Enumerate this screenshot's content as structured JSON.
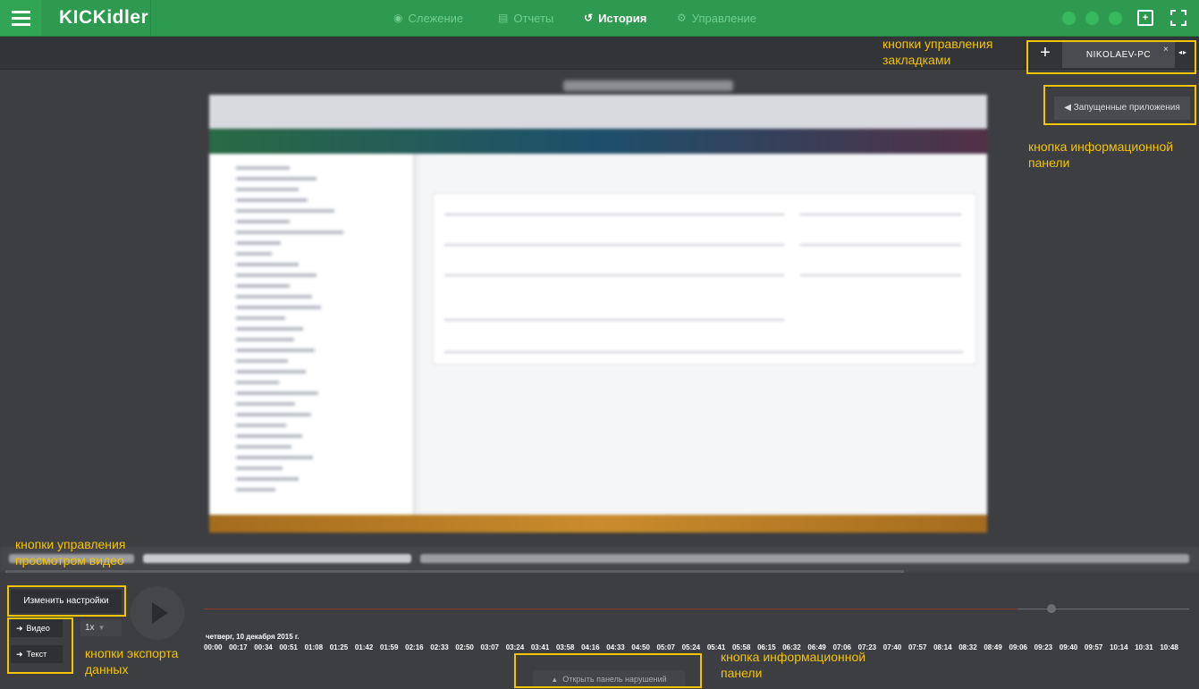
{
  "app": {
    "logo": "KICKidler"
  },
  "nav": [
    {
      "label": "Слежение",
      "icon": "eye-icon",
      "active": false
    },
    {
      "label": "Отчеты",
      "icon": "document-icon",
      "active": false
    },
    {
      "label": "История",
      "icon": "history-icon",
      "active": true
    },
    {
      "label": "Управление",
      "icon": "gear-icon",
      "active": false
    }
  ],
  "tabs": {
    "add_label": "+",
    "active_tab": "NIKOLAEV-PC",
    "close": "×",
    "arrows": "◂▸"
  },
  "buttons": {
    "running_apps": "Запущенные приложения",
    "change_settings": "Изменить настройки",
    "export_video": "Видео",
    "export_text": "Текст",
    "speed": "1x",
    "open_violations": "Открыть панель нарушений"
  },
  "annotations": {
    "tab_controls": [
      "кнопки управления",
      "закладками"
    ],
    "info_panel_top": [
      "кнопка информационной",
      "панели"
    ],
    "video_controls": [
      "кнопки управления",
      "просмотром видео"
    ],
    "export_controls": [
      "кнопки экспорта",
      "данных"
    ],
    "info_panel_bottom": [
      "кнопка информационной",
      "панели"
    ]
  },
  "timeline": {
    "date": "четверг, 10 декабря 2015 г.",
    "ticks": [
      "00:00",
      "00:17",
      "00:34",
      "00:51",
      "01:08",
      "01:25",
      "01:42",
      "01:59",
      "02:16",
      "02:33",
      "02:50",
      "03:07",
      "03:24",
      "03:41",
      "03:58",
      "04:16",
      "04:33",
      "04:50",
      "05:07",
      "05:24",
      "05:41",
      "05:58",
      "06:15",
      "06:32",
      "06:49",
      "07:06",
      "07:23",
      "07:40",
      "07:57",
      "08:14",
      "08:32",
      "08:49",
      "09:06",
      "09:23",
      "09:40",
      "09:57",
      "10:14",
      "10:31",
      "10:48"
    ]
  },
  "colors": {
    "accent": "#2e9a4f",
    "annotation": "#f4c400",
    "background": "#3d3e42"
  }
}
